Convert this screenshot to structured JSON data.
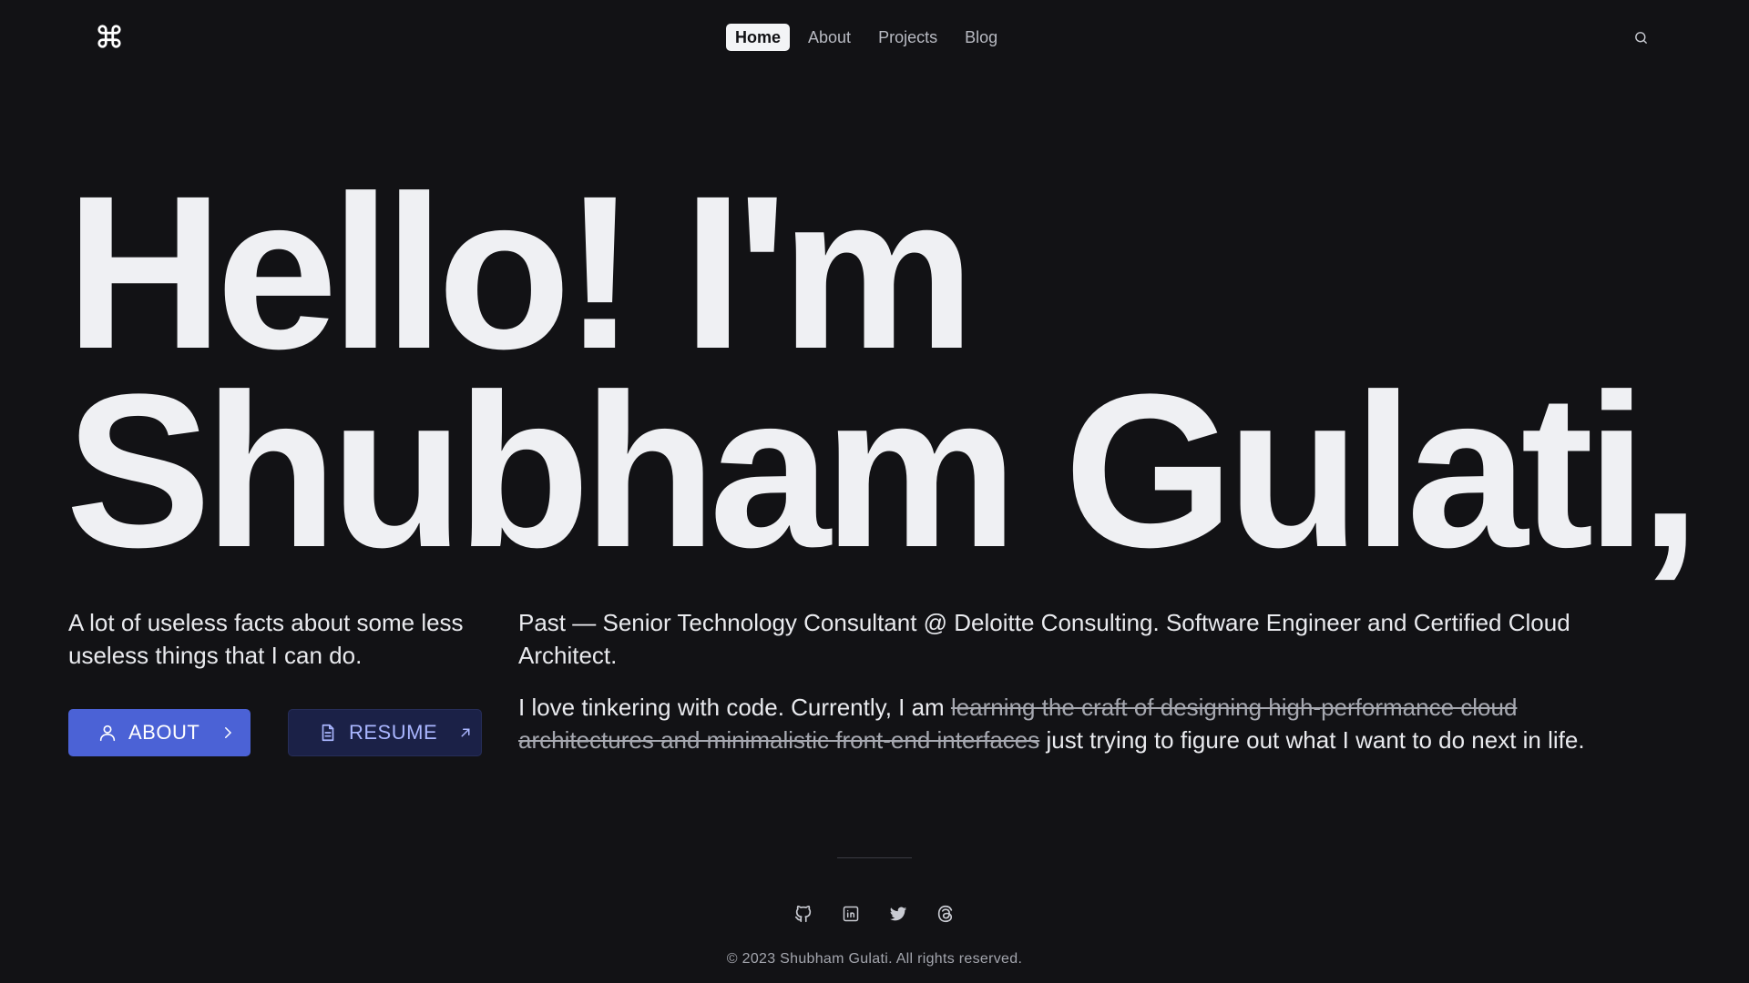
{
  "header": {
    "logo_icon": "command-icon",
    "nav": [
      {
        "label": "Home",
        "active": true
      },
      {
        "label": "About",
        "active": false
      },
      {
        "label": "Projects",
        "active": false
      },
      {
        "label": "Blog",
        "active": false
      }
    ],
    "search_icon": "search-icon"
  },
  "hero": {
    "line1": "Hello! I'm",
    "line2": "Shubham Gulati,"
  },
  "intro": {
    "text": "A lot of useless facts about some less useless things that I can do."
  },
  "buttons": {
    "about": {
      "label": "ABOUT",
      "icon": "user-icon",
      "trailing_icon": "chevron-right-icon"
    },
    "resume": {
      "label": "RESUME",
      "icon": "document-icon",
      "trailing_icon": "arrow-up-right-icon"
    }
  },
  "bio": {
    "para1": "Past — Senior Technology Consultant @ Deloitte Consulting. Software Engineer and Certified Cloud Architect.",
    "para2_prefix": "I love tinkering with code. Currently, I am ",
    "para2_strike": "learning the craft of designing high-performance cloud architectures and minimalistic front-end interfaces",
    "para2_suffix": " just trying to figure out what I want to do next in life."
  },
  "footer": {
    "socials": [
      "github-icon",
      "linkedin-icon",
      "twitter-icon",
      "threads-icon"
    ],
    "copyright": "© 2023 Shubham Gulati. All rights reserved."
  },
  "colors": {
    "background": "#121215",
    "text": "#eeeff2",
    "about_button": "#4b62d6",
    "resume_button": "#1b2147",
    "resume_text": "#aab6ff"
  }
}
